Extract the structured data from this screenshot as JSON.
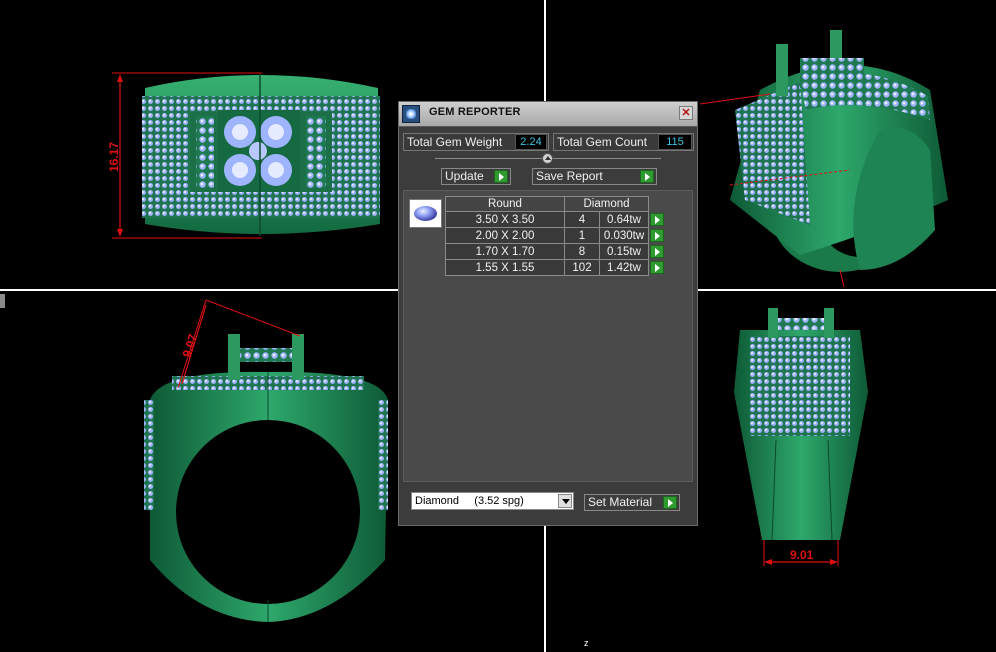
{
  "viewport": {
    "dimensions": {
      "top_left_height": "16.17",
      "bottom_left_width": "9.07",
      "bottom_right_width": "9.01"
    },
    "axis_label": "z"
  },
  "gem_reporter": {
    "title": "GEM REPORTER",
    "total_gem_weight_label": "Total Gem Weight",
    "total_gem_weight_value": "2.24",
    "total_gem_count_label": "Total Gem Count",
    "total_gem_count_value": "115",
    "update_label": "Update",
    "save_report_label": "Save Report",
    "table": {
      "headers": [
        "Round",
        "Diamond"
      ],
      "rows": [
        {
          "size": "3.50 X 3.50",
          "count": "4",
          "weight": "0.64tw"
        },
        {
          "size": "2.00 X 2.00",
          "count": "1",
          "weight": "0.030tw"
        },
        {
          "size": "1.70 X 1.70",
          "count": "8",
          "weight": "0.15tw"
        },
        {
          "size": "1.55 X 1.55",
          "count": "102",
          "weight": "1.42tw"
        }
      ]
    },
    "material_select": "Diamond     (3.52 spg)",
    "set_material_label": "Set Material"
  }
}
